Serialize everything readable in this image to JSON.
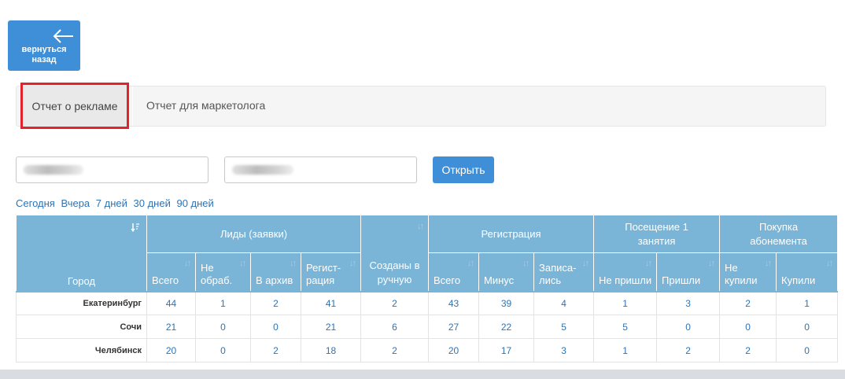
{
  "back_button": {
    "label": "вернуться\nназад"
  },
  "tabs": [
    {
      "label": "Отчет о рекламе",
      "active": true
    },
    {
      "label": "Отчет для маркетолога",
      "active": false
    }
  ],
  "open_button": {
    "label": "Открыть"
  },
  "quick_ranges": [
    "Сегодня",
    "Вчера",
    "7 дней",
    "30 дней",
    "90 дней"
  ],
  "table": {
    "city_header": "Город",
    "groups": {
      "leads": "Лиды (заявки)",
      "manual": "Созданы в ручную",
      "registration": "Регистрация",
      "visit": "Посещение 1 занятия",
      "purchase": "Покупка абонемента"
    },
    "subheaders": {
      "leads_total": "Всего",
      "leads_unprocessed": "Не обраб.",
      "leads_archive": "В архив",
      "leads_registration": "Регист-рация",
      "reg_total": "Всего",
      "reg_minus": "Минус",
      "reg_booked": "Записа-лись",
      "visit_no": "Не пришли",
      "visit_yes": "Пришли",
      "buy_no": "Не купили",
      "buy_yes": "Купили"
    },
    "rows": [
      {
        "city": "Екатеринбург",
        "values": [
          "44",
          "1",
          "2",
          "41",
          "2",
          "43",
          "39",
          "4",
          "1",
          "3",
          "2",
          "1"
        ]
      },
      {
        "city": "Сочи",
        "values": [
          "21",
          "0",
          "0",
          "21",
          "6",
          "27",
          "22",
          "5",
          "5",
          "0",
          "0",
          "0"
        ]
      },
      {
        "city": "Челябинск",
        "values": [
          "20",
          "0",
          "2",
          "18",
          "2",
          "20",
          "17",
          "3",
          "1",
          "2",
          "2",
          "0"
        ]
      }
    ]
  },
  "colors": {
    "primary": "#3e8fd8",
    "table_header": "#7ab4d7",
    "link": "#2d73b5",
    "highlight": "#e3232c"
  }
}
